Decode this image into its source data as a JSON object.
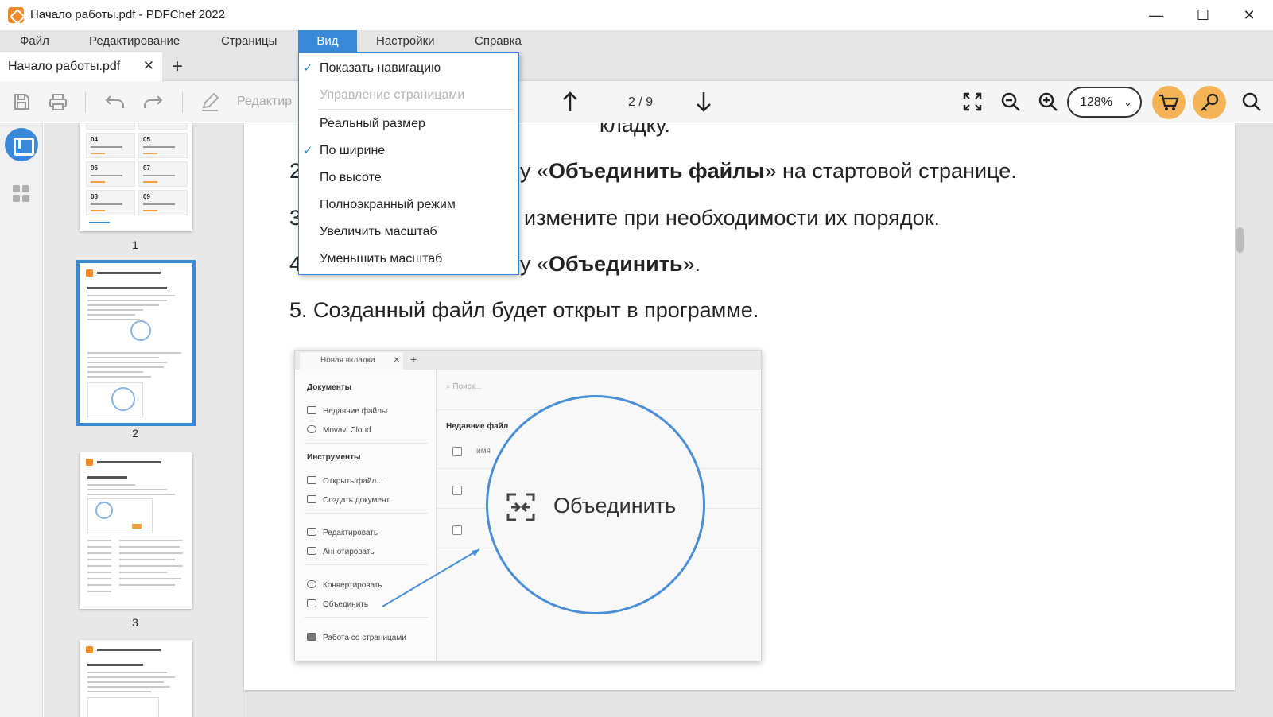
{
  "window": {
    "title": "Начало работы.pdf - PDFChef 2022",
    "minimize": "—",
    "maximize": "☐",
    "close": "✕"
  },
  "menubar": {
    "items": [
      {
        "label": "Файл"
      },
      {
        "label": "Редактирование"
      },
      {
        "label": "Страницы"
      },
      {
        "label": "Вид"
      },
      {
        "label": "Настройки"
      },
      {
        "label": "Справка"
      }
    ],
    "active": "Вид"
  },
  "tabs": {
    "doc_tab": "Начало работы.pdf",
    "close": "✕",
    "new_tab": "+"
  },
  "toolbar": {
    "edit_label": "Редактир",
    "page_counter": "2 / 9",
    "zoom": "128%",
    "zoom_chevron": "⌄"
  },
  "view_menu": {
    "items": [
      {
        "label": "Показать навигацию",
        "checked": true,
        "enabled": true
      },
      {
        "label": "Управление страницами",
        "checked": false,
        "enabled": false
      },
      {
        "label": "Реальный размер",
        "checked": false,
        "enabled": true
      },
      {
        "label": "По ширине",
        "checked": true,
        "enabled": true
      },
      {
        "label": "По высоте",
        "checked": false,
        "enabled": true
      },
      {
        "label": "Полноэкранный режим",
        "checked": false,
        "enabled": true
      },
      {
        "label": "Увеличить масштаб",
        "checked": false,
        "enabled": true
      },
      {
        "label": "Уменьшить масштаб",
        "checked": false,
        "enabled": true
      }
    ],
    "check_glyph": "✓"
  },
  "thumbnails": {
    "pages": [
      "1",
      "2",
      "3"
    ],
    "selected": "2",
    "page1_cells": [
      "04",
      "05",
      "06",
      "07",
      "08",
      "09"
    ]
  },
  "document": {
    "line1_tail": "кладку.",
    "line2_num": "2",
    "line2_pre": "у «",
    "line2_bold": "Объединить файлы",
    "line2_post": "» на стартовой странице.",
    "line3_num": "3",
    "line3_tail": "измените при необходимости их порядок.",
    "line4_num": "4",
    "line4_pre": "у «",
    "line4_bold": "Объединить",
    "line4_post": "».",
    "line5": "5. Созданный файл будет открыт в программе."
  },
  "figure": {
    "tab_label": "Новая вкладка",
    "tab_close": "✕",
    "new_tab": "+",
    "section_documents": "Документы",
    "recent_files": "Недавние файлы",
    "movavi_cloud": "Movavi Cloud",
    "section_tools": "Инструменты",
    "open_file": "Открыть файл...",
    "create_document": "Создать документ",
    "edit": "Редактировать",
    "annotate": "Аннотировать",
    "convert": "Конвертировать",
    "merge": "Объединить",
    "pages_work": "Работа со страницами",
    "search": "Поиск...",
    "recent_heading": "Недавние файл",
    "name_col": "имя",
    "big_merge": "Объединить"
  },
  "colors": {
    "accent": "#3a88d8",
    "orange": "#f5b358",
    "menubar_bg": "#e5e5e5"
  }
}
